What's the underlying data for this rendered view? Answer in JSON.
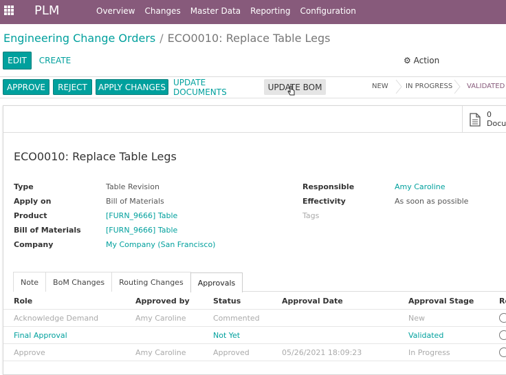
{
  "topbar": {
    "app_name": "PLM",
    "menu": [
      "Overview",
      "Changes",
      "Master Data",
      "Reporting",
      "Configuration"
    ]
  },
  "breadcrumb": {
    "parent": "Engineering Change Orders",
    "separator": "/",
    "current": "ECO0010: Replace Table Legs"
  },
  "controls": {
    "edit": "EDIT",
    "create": "CREATE",
    "action": "Action"
  },
  "statusbar_buttons": {
    "approve": "APPROVE",
    "reject": "REJECT",
    "apply_changes": "APPLY CHANGES",
    "update_documents": "UPDATE DOCUMENTS",
    "update_bom": "UPDATE BOM"
  },
  "stages": [
    "NEW",
    "IN PROGRESS",
    "VALIDATED"
  ],
  "active_stage": "VALIDATED",
  "smart_button": {
    "count": "0",
    "label": "Docume"
  },
  "record": {
    "title": "ECO0010: Replace Table Legs",
    "left_fields": [
      {
        "label": "Type",
        "value": "Table Revision"
      },
      {
        "label": "Apply on",
        "value": "Bill of Materials"
      },
      {
        "label": "Product",
        "value": "[FURN_9666] Table"
      },
      {
        "label": "Bill of Materials",
        "value": "[FURN_9666] Table"
      },
      {
        "label": "Company",
        "value": "My Company (San Francisco)"
      }
    ],
    "right_fields": [
      {
        "label": "Responsible",
        "value": "Amy Caroline"
      },
      {
        "label": "Effectivity",
        "value": "As soon as possible"
      }
    ],
    "tags_placeholder": "Tags"
  },
  "tabs": [
    "Note",
    "BoM Changes",
    "Routing Changes",
    "Approvals"
  ],
  "active_tab": "Approvals",
  "approvals": {
    "headers": [
      "Role",
      "Approved by",
      "Status",
      "Approval Date",
      "Approval Stage",
      "Re"
    ],
    "rows": [
      {
        "role": "Acknowledge Demand",
        "approved_by": "Amy Caroline",
        "status": "Commented",
        "date": "",
        "stage": "New"
      },
      {
        "role": "Final Approval",
        "approved_by": "",
        "status": "Not Yet",
        "date": "",
        "stage": "Validated"
      },
      {
        "role": "Approve",
        "approved_by": "Amy Caroline",
        "status": "Approved",
        "date": "05/26/2021 18:09:23",
        "stage": "In Progress"
      }
    ]
  },
  "colors": {
    "brand": "#875a7b",
    "accent": "#00a09d"
  }
}
